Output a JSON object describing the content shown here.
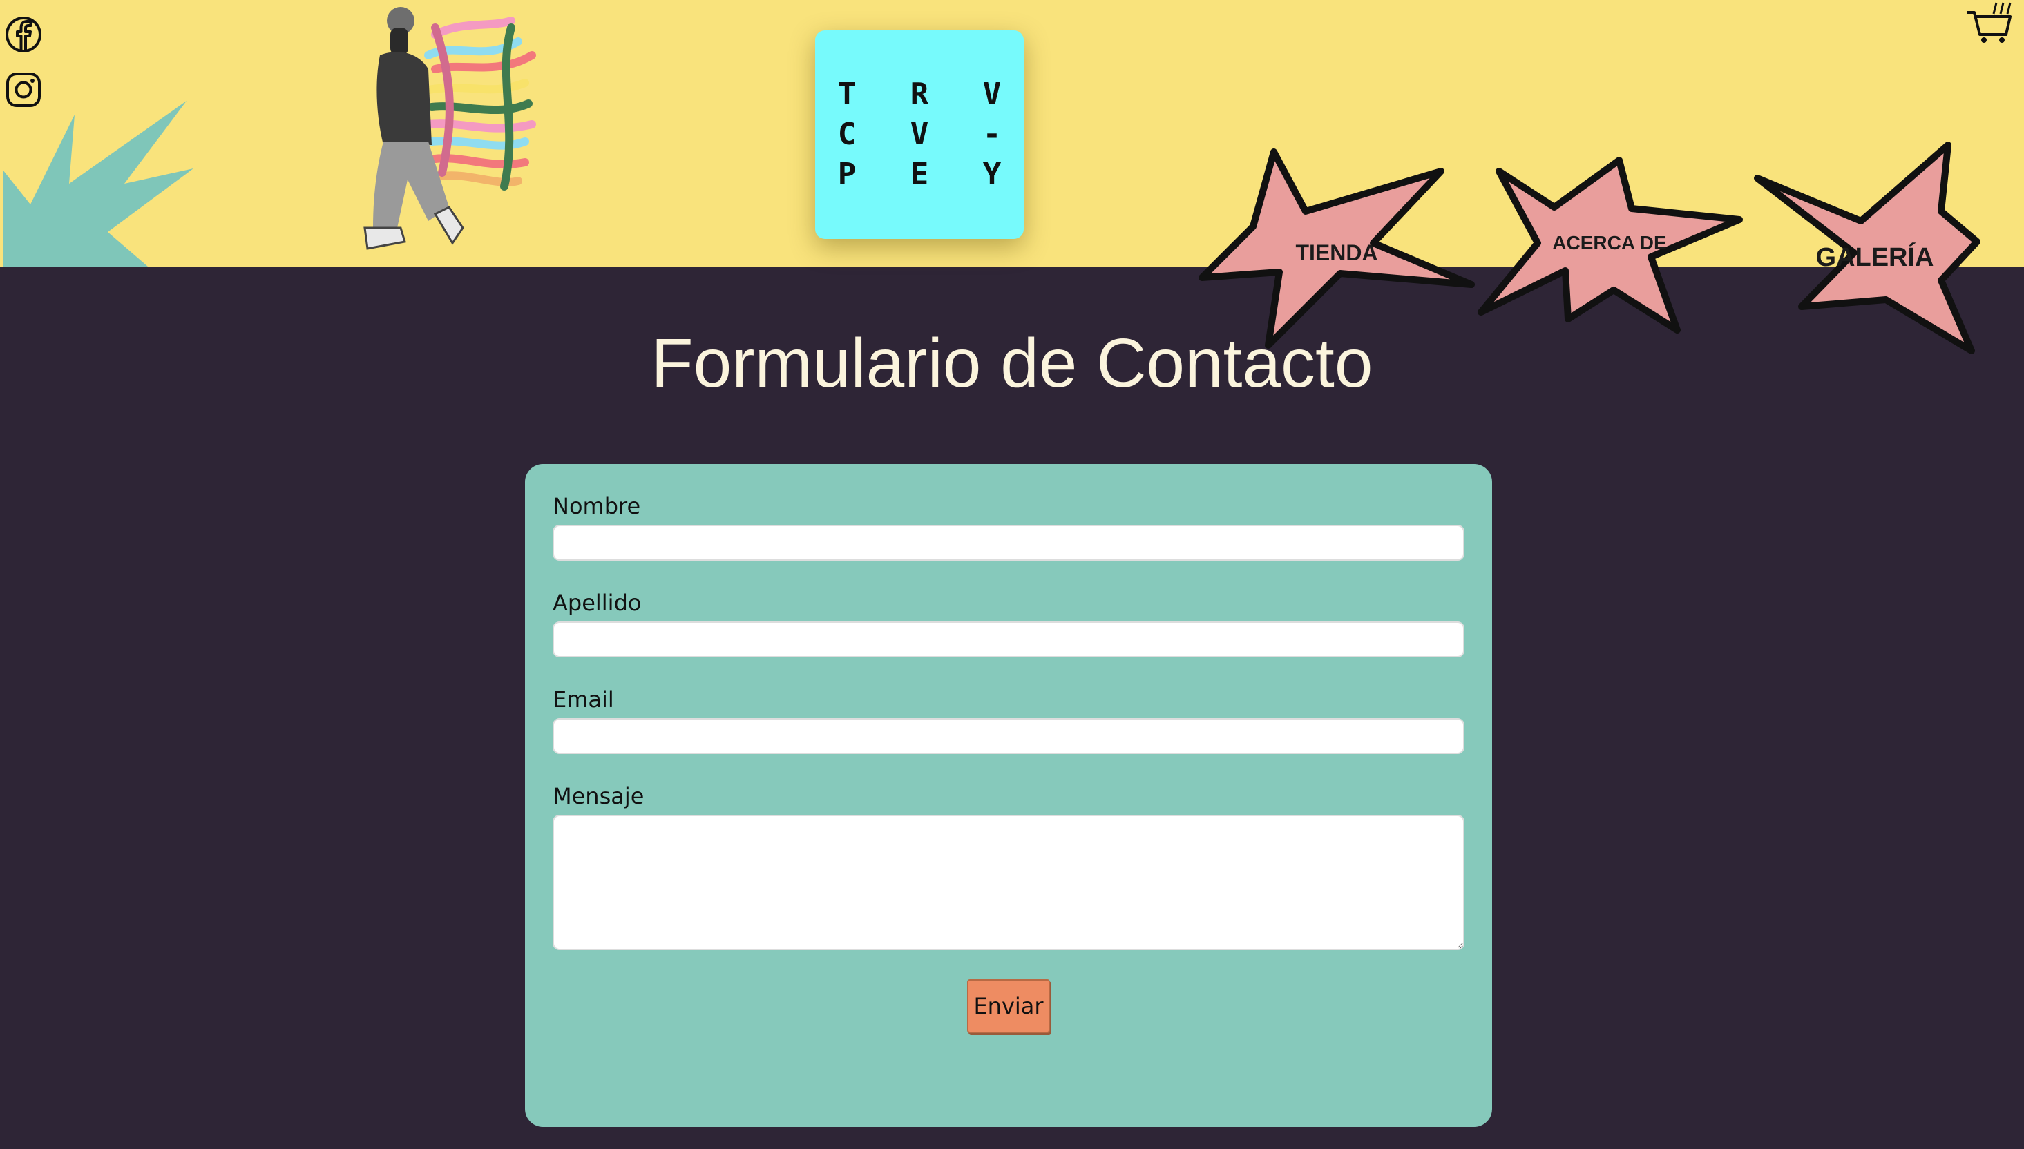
{
  "header": {
    "social": [
      {
        "name": "facebook",
        "icon": "facebook-icon"
      },
      {
        "name": "instagram",
        "icon": "instagram-icon"
      }
    ],
    "logo": {
      "lines": [
        "T R V",
        "C V -",
        "P E Y"
      ]
    },
    "cart_icon": "shopping-cart-icon",
    "nav": [
      {
        "label": "TIENDA"
      },
      {
        "label": "ACERCA DE"
      },
      {
        "label": "GALERÍA"
      }
    ],
    "colors": {
      "header_bg": "#f9e37c",
      "logo_bg": "#77fafc",
      "star_fill": "#e99e9c",
      "splash": "#7fc6b9"
    }
  },
  "main": {
    "title": "Formulario de Contacto",
    "form": {
      "fields": [
        {
          "label": "Nombre",
          "value": ""
        },
        {
          "label": "Apellido",
          "value": ""
        },
        {
          "label": "Email",
          "value": ""
        },
        {
          "label": "Mensaje",
          "value": ""
        }
      ],
      "submit_label": "Enviar"
    },
    "colors": {
      "page_bg": "#2e2536",
      "card_bg": "#86c9bb",
      "button_bg": "#ee8c62",
      "title": "#fbf4dd"
    }
  }
}
